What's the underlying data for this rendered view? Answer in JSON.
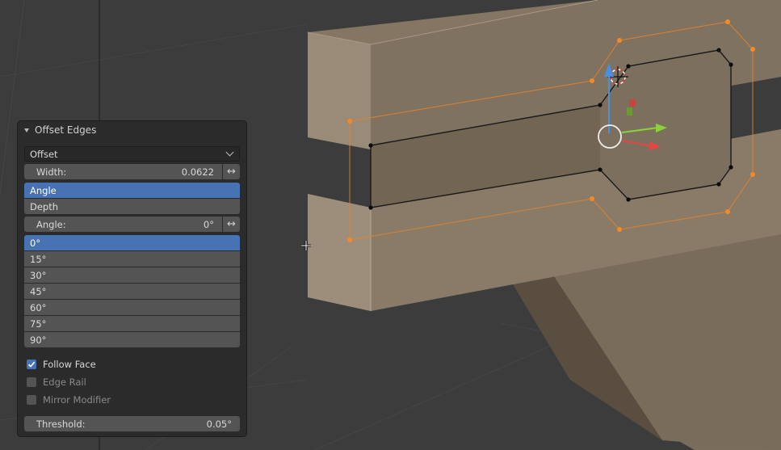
{
  "panel": {
    "title": "Offset Edges",
    "mode_value": "Offset",
    "width": {
      "label": "Width:",
      "value": "0.0622"
    },
    "geometry_mode": {
      "options": [
        "Angle",
        "Depth"
      ],
      "selected": "Angle"
    },
    "angle": {
      "label": "Angle:",
      "value": "0°"
    },
    "angle_presets": {
      "options": [
        "0°",
        "15°",
        "30°",
        "45°",
        "60°",
        "75°",
        "90°"
      ],
      "selected": "0°"
    },
    "follow_face": {
      "label": "Follow Face",
      "checked": true
    },
    "edge_rail": {
      "label": "Edge Rail",
      "checked": false
    },
    "mirror_modifier": {
      "label": "Mirror Modifier",
      "checked": false
    },
    "threshold": {
      "label": "Threshold:",
      "value": "0.05°"
    }
  },
  "colors": {
    "accent": "#4772b3",
    "panel_bg": "#2b2b2b",
    "field_bg": "#545454",
    "mesh_face": "#7f7160",
    "selection_orange": "#f08a2a",
    "viewport_bg": "#3d3d3d"
  },
  "icons": {
    "link_arrows": "↔",
    "dropdown": "chevron-down",
    "checkbox_on": "✓"
  }
}
